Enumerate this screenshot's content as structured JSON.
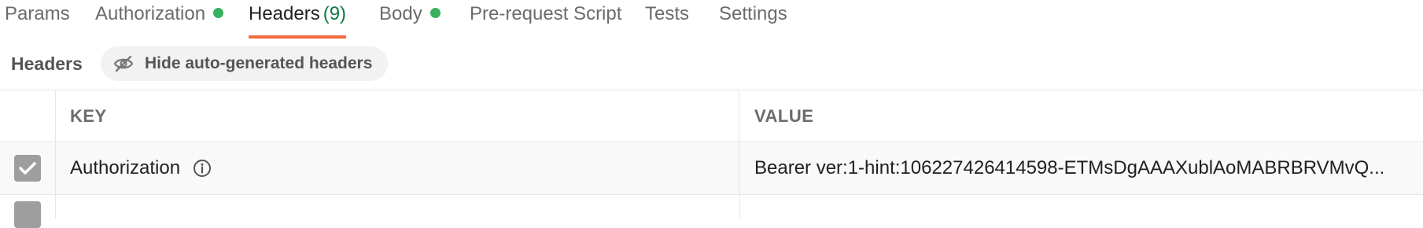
{
  "tabs": {
    "params": "Params",
    "authorization": "Authorization",
    "headers": "Headers",
    "headers_count": "(9)",
    "body": "Body",
    "prerequest": "Pre-request Script",
    "tests": "Tests",
    "settings": "Settings"
  },
  "colors": {
    "accent": "#f26b3a",
    "status_dot": "#38b15f",
    "count": "#0c7b3f"
  },
  "subbar": {
    "title": "Headers",
    "hide_button": "Hide auto-generated headers",
    "hide_icon": "eye-off-icon"
  },
  "table": {
    "columns": {
      "key": "KEY",
      "value": "VALUE"
    },
    "rows": [
      {
        "checked": true,
        "key": "Authorization",
        "value": "Bearer ver:1-hint:106227426414598-ETMsDgAAAXublAoMABRBRVMvQ..."
      }
    ]
  }
}
